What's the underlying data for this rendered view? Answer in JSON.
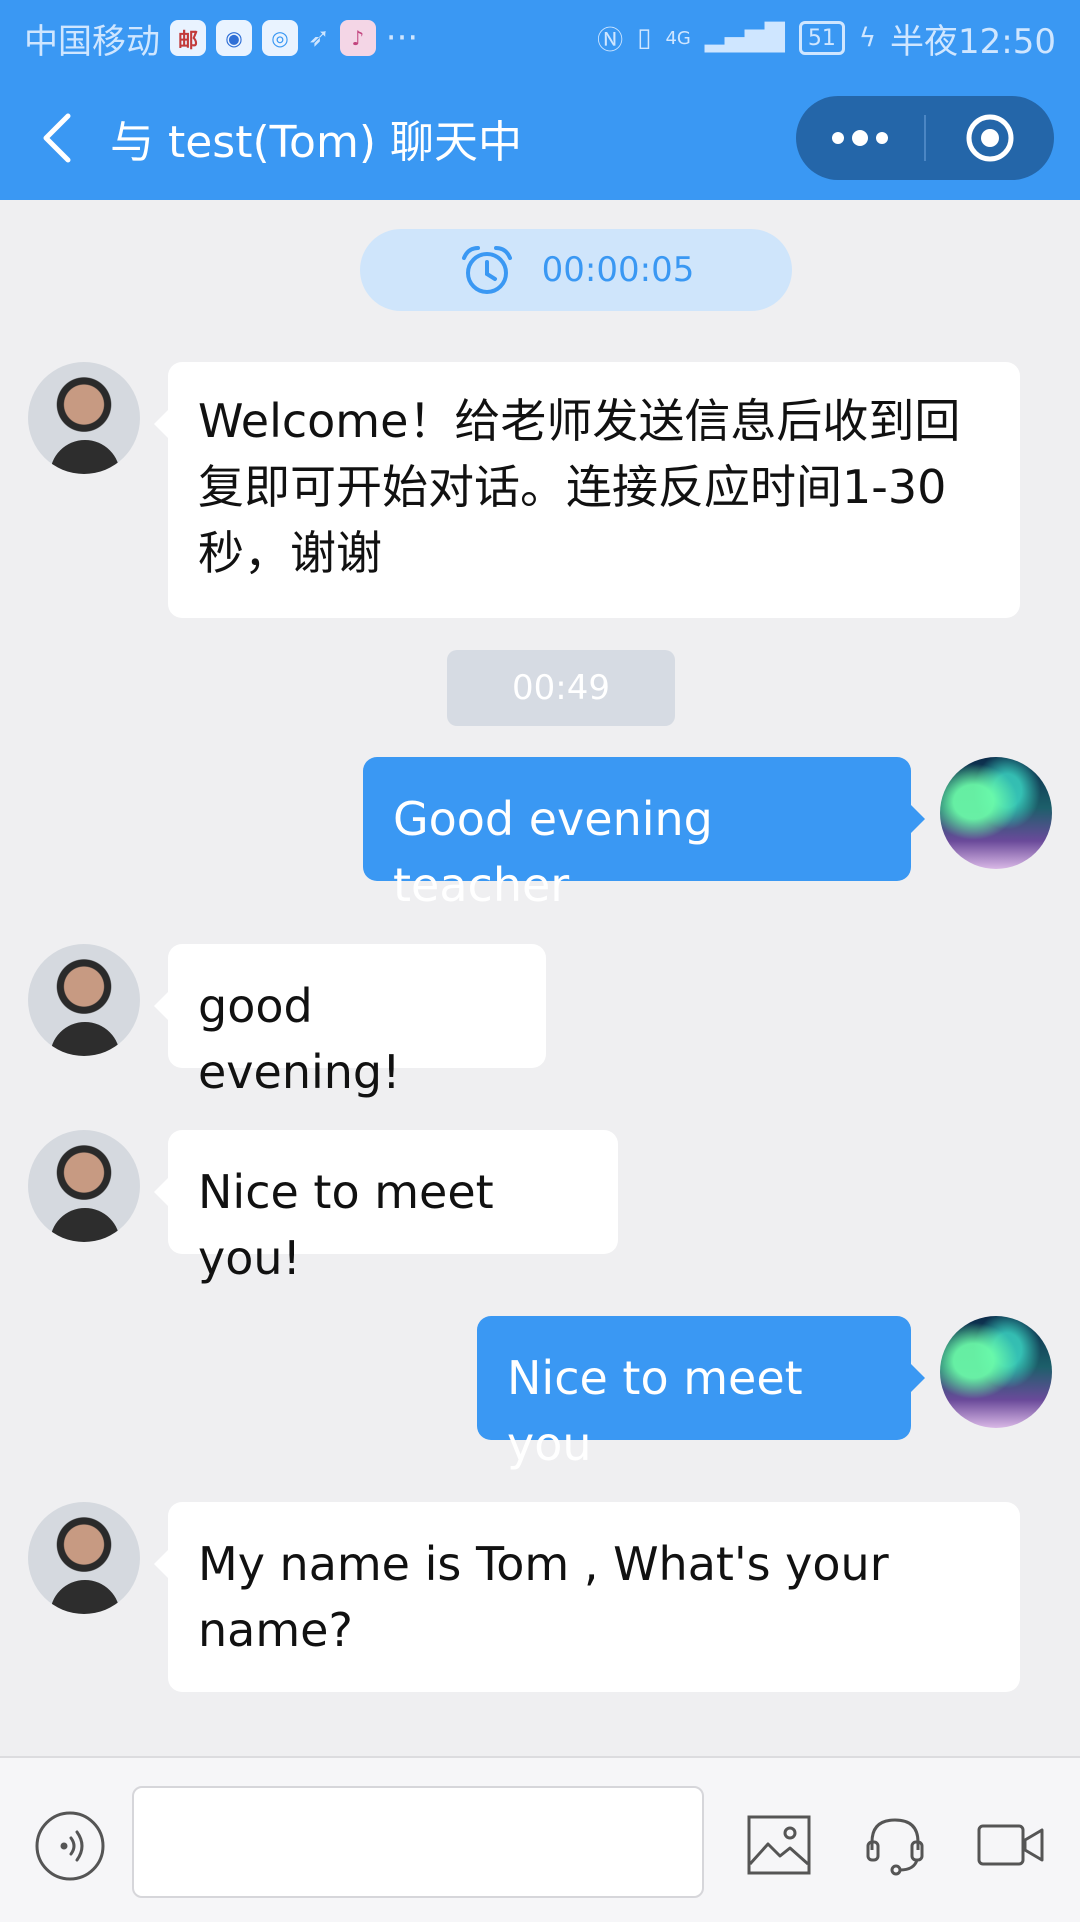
{
  "status_bar": {
    "carrier": "中国移动",
    "app_icons": [
      "mail-app-icon",
      "baidu-app-icon",
      "browser-app-icon",
      "bird-app-icon",
      "music-app-icon"
    ],
    "more": "···",
    "signal_type": "4G",
    "battery": "51",
    "time": "半夜12:50"
  },
  "nav": {
    "title": "与 test(Tom) 聊天中"
  },
  "timer": {
    "value": "00:00:05"
  },
  "messages": [
    {
      "side": "in",
      "text": "Welcome！给老师发送信息后收到回复即可开始对话。连接反应时间1-30秒，谢谢"
    },
    {
      "side": "time",
      "text": "00:49"
    },
    {
      "side": "out",
      "text": "Good evening teacher"
    },
    {
      "side": "in",
      "text": "good evening!"
    },
    {
      "side": "in",
      "text": "Nice to meet you!"
    },
    {
      "side": "out",
      "text": "Nice to meet you"
    },
    {
      "side": "in",
      "text": "My name is Tom , What's your name?"
    }
  ],
  "composer": {
    "value": "",
    "placeholder": ""
  },
  "colors": {
    "accent": "#3a98f3",
    "capsule": "#2466a9",
    "background": "#efeff1"
  }
}
